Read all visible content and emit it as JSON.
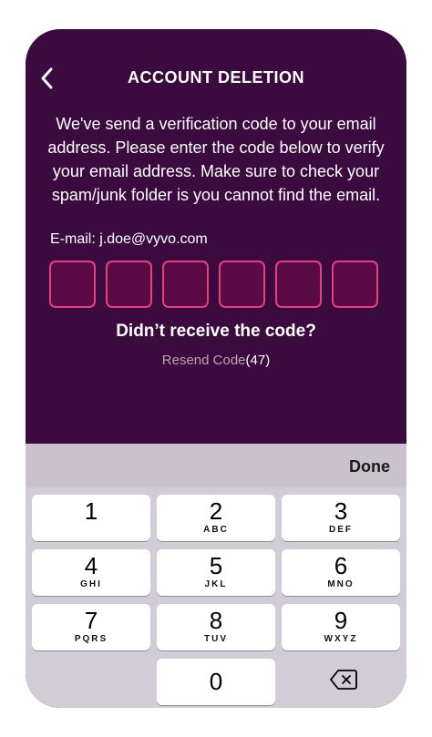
{
  "header": {
    "title": "ACCOUNT DELETION",
    "back_icon": "chevron-left-icon"
  },
  "main": {
    "description": "We've send a verification code to your email address. Please enter the code below to verify your email address. Make sure to check your spam/junk folder is you cannot find the email.",
    "email_line": "E-mail: j.doe@vyvo.com",
    "code_boxes": [
      "",
      "",
      "",
      "",
      "",
      ""
    ],
    "no_code_prompt": "Didn’t receive the code?",
    "resend_label": "Resend Code",
    "resend_countdown": "(47)"
  },
  "keyboard": {
    "done_label": "Done",
    "keys": [
      {
        "num": "1",
        "letters": ""
      },
      {
        "num": "2",
        "letters": "ABC"
      },
      {
        "num": "3",
        "letters": "DEF"
      },
      {
        "num": "4",
        "letters": "GHI"
      },
      {
        "num": "5",
        "letters": "JKL"
      },
      {
        "num": "6",
        "letters": "MNO"
      },
      {
        "num": "7",
        "letters": "PQRS"
      },
      {
        "num": "8",
        "letters": "TUV"
      },
      {
        "num": "9",
        "letters": "WXYZ"
      }
    ],
    "zero": "0",
    "delete_icon": "backspace-icon"
  },
  "colors": {
    "background": "#3b0a3e",
    "code_box_fill": "#5a0a45",
    "code_box_border": "#e8407f",
    "keyboard_bg": "#d2ccd7"
  }
}
